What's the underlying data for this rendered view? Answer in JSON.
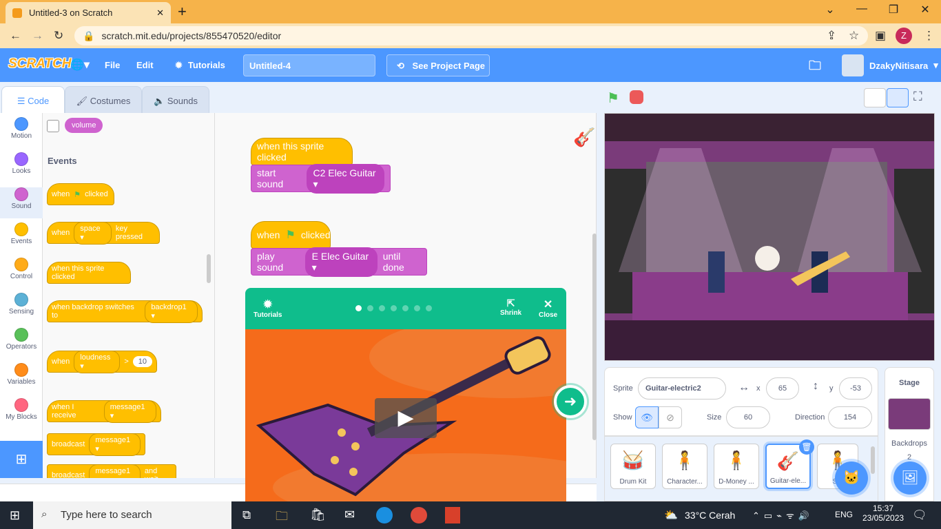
{
  "browser": {
    "tab_title": "Untitled-3 on Scratch",
    "tab_close": "✕",
    "new_tab": "+",
    "url": "scratch.mit.edu/projects/855470520/editor",
    "profile_initial": "Z"
  },
  "menubar": {
    "logo": "SCRATCH",
    "file": "File",
    "edit": "Edit",
    "tutorials": "Tutorials",
    "project_title": "Untitled-4",
    "see_project": "See Project Page",
    "username": "DzakyNitisara"
  },
  "tabs": {
    "code": "Code",
    "costumes": "Costumes",
    "sounds": "Sounds"
  },
  "categories": [
    {
      "label": "Motion",
      "color": "#4c97ff"
    },
    {
      "label": "Looks",
      "color": "#9966ff"
    },
    {
      "label": "Sound",
      "color": "#cf63cf"
    },
    {
      "label": "Events",
      "color": "#ffbf00"
    },
    {
      "label": "Control",
      "color": "#ffab19"
    },
    {
      "label": "Sensing",
      "color": "#5cb1d6"
    },
    {
      "label": "Operators",
      "color": "#59c059"
    },
    {
      "label": "Variables",
      "color": "#ff8c1a"
    },
    {
      "label": "My Blocks",
      "color": "#ff6680"
    }
  ],
  "palette": {
    "volume": "volume",
    "events_heading": "Events",
    "when": "when",
    "clicked": "clicked",
    "space": "space",
    "key_pressed": "key pressed",
    "when_sprite_clicked": "when this sprite clicked",
    "when_backdrop": "when backdrop switches to",
    "backdrop1": "backdrop1",
    "loudness": "loudness",
    "gt": ">",
    "ten": "10",
    "when_receive": "when I receive",
    "message1": "message1",
    "broadcast": "broadcast",
    "and_wait": "and wait"
  },
  "workspace": {
    "script1_hat": "when this sprite clicked",
    "script1_cmd": "start sound",
    "script1_sound": "C2 Elec Guitar",
    "script2_when": "when",
    "script2_clicked": "clicked",
    "script2_cmd": "play sound",
    "script2_sound": "E Elec Guitar",
    "script2_until": "until done"
  },
  "tutorial": {
    "label": "Tutorials",
    "shrink": "Shrink",
    "close": "Close",
    "dots_total": 7,
    "dots_active": 1
  },
  "sprite_info": {
    "sprite_label": "Sprite",
    "sprite_name": "Guitar-electric2",
    "x_label": "x",
    "x": "65",
    "y_label": "y",
    "y": "-53",
    "show_label": "Show",
    "size_label": "Size",
    "size": "60",
    "direction_label": "Direction",
    "direction": "154"
  },
  "sprites": [
    "Drum Kit",
    "Character...",
    "D-Money ...",
    "Guitar-ele...",
    "S..."
  ],
  "stage_panel": {
    "title": "Stage",
    "backdrops_label": "Backdrops",
    "backdrops_count": "2"
  },
  "taskbar": {
    "search_placeholder": "Type here to search",
    "weather": "33°C  Cerah",
    "lang": "ENG",
    "time": "15:37",
    "date": "23/05/2023"
  }
}
